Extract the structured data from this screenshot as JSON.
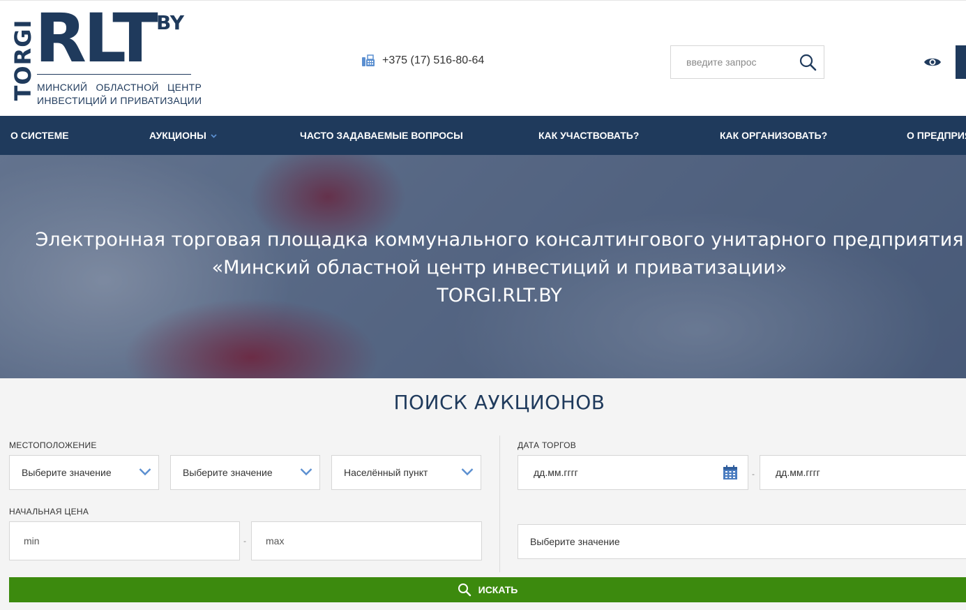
{
  "header": {
    "logo": {
      "torgi": "TORGI",
      "rlt": "RLT",
      "by": "BY",
      "subtitle_line1": "МИНСКИЙ ОБЛАСТНОЙ ЦЕНТР",
      "subtitle_line2": "ИНВЕСТИЦИЙ И ПРИВАТИЗАЦИИ"
    },
    "phone": "+375 (17) 516-80-64",
    "search": {
      "placeholder": "введите запрос"
    }
  },
  "nav": {
    "items": [
      {
        "label": "О СИСТЕМЕ"
      },
      {
        "label": "АУКЦИОНЫ"
      },
      {
        "label": "ЧАСТО ЗАДАВАЕМЫЕ ВОПРОСЫ"
      },
      {
        "label": "КАК УЧАСТВОВАТЬ?"
      },
      {
        "label": "КАК ОРГАНИЗОВАТЬ?"
      },
      {
        "label": "О ПРЕДПРИЯ"
      }
    ]
  },
  "hero": {
    "line1": "Электронная торговая площадка коммунального консалтингового унитарного предприятия",
    "line2": "«Минский областной центр инвестиций и приватизации»",
    "line3": "TORGI.RLT.BY"
  },
  "search_section": {
    "title": "ПОИСК АУКЦИОНОВ",
    "location_label": "МЕСТОПОЛОЖЕНИЕ",
    "location_select1": "Выберите значение",
    "location_select2": "Выберите значение",
    "location_select3": "Населённый пункт",
    "price_label": "НАЧАЛЬНАЯ ЦЕНА",
    "price_min": "min",
    "price_max": "max",
    "date_label": "ДАТА ТОРГОВ",
    "date_from": "дд.мм.гггг",
    "date_to": "дд.мм.гггг",
    "extra_select": "Выберите значение",
    "submit_label": "ИСКАТЬ",
    "range_separator": "-"
  },
  "colors": {
    "brand_navy": "#1f3a5c",
    "accent_blue": "#5b8fd0",
    "submit_green": "#3c8a0e"
  }
}
